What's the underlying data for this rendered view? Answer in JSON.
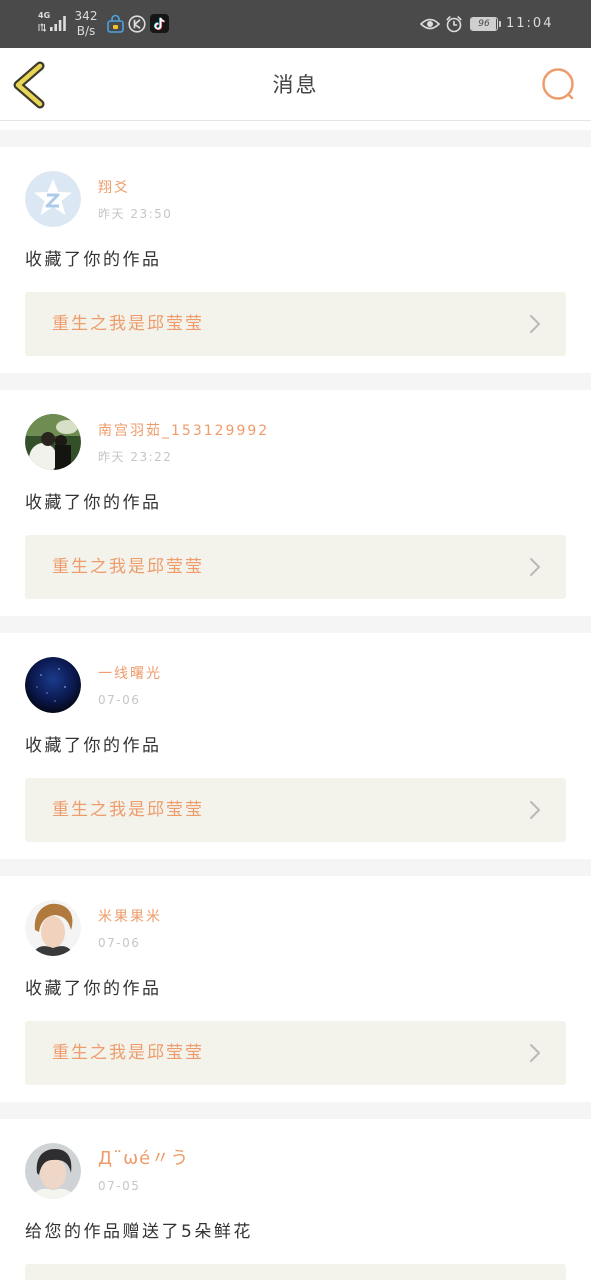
{
  "status_bar": {
    "network_type": "4G",
    "net_speed": "342",
    "net_speed_unit": "B/s",
    "battery_level": "96",
    "time": "11:04",
    "left_icons": [
      "signal-icon",
      "lock-bag-icon",
      "k-circle-icon",
      "tiktok-icon"
    ],
    "right_icons": [
      "eye-icon",
      "alarm-icon",
      "battery-icon"
    ]
  },
  "header": {
    "back_icon": "back-chevron-icon",
    "title": "消息",
    "search_icon": "search-icon"
  },
  "notifications": [
    {
      "user_name": "翔爻",
      "time": "昨天 23:50",
      "action_text": "收藏了你的作品",
      "work_title": "重生之我是邱莹莹"
    },
    {
      "user_name": "南宫羽茹_153129992",
      "time": "昨天 23:22",
      "action_text": "收藏了你的作品",
      "work_title": "重生之我是邱莹莹"
    },
    {
      "user_name": "一线曙光",
      "time": "07-06",
      "action_text": "收藏了你的作品",
      "work_title": "重生之我是邱莹莹"
    },
    {
      "user_name": "米果果米",
      "time": "07-06",
      "action_text": "收藏了你的作品",
      "work_title": "重生之我是邱莹莹"
    },
    {
      "user_name": "Д¨ωé〃う",
      "time": "07-05",
      "action_text": "给您的作品赠送了5朵鲜花"
    }
  ],
  "colors": {
    "status_bar_bg": "#4a4a4a",
    "accent": "#ee9c6c",
    "back_chevron": "#e9d555",
    "work_box_bg": "#f3f3ec",
    "separator": "#f5f5f5"
  }
}
